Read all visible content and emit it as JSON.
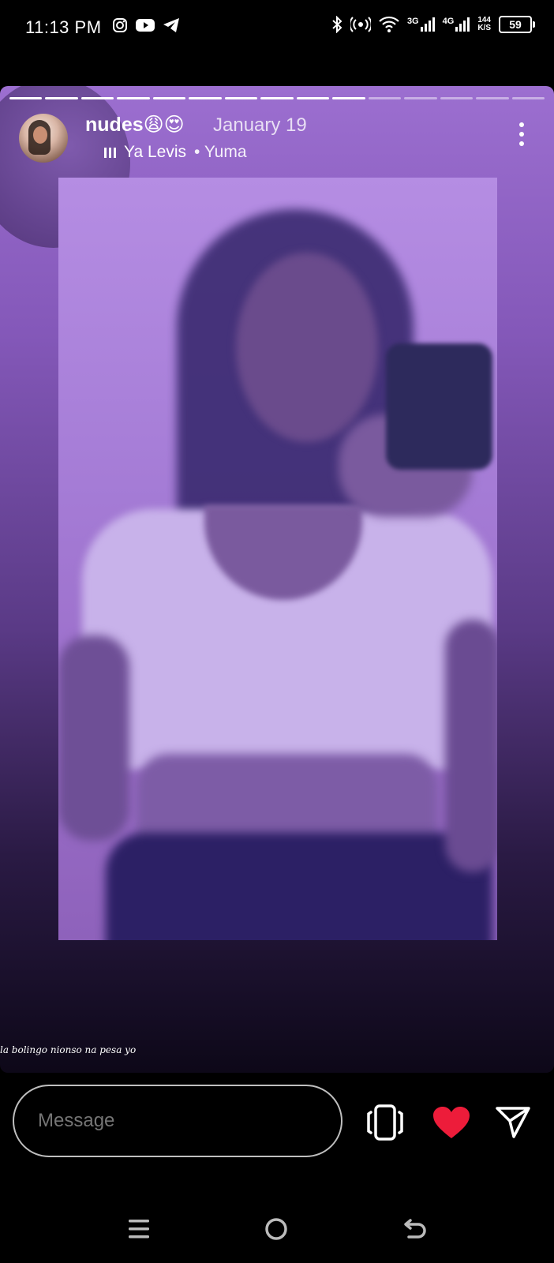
{
  "status_bar": {
    "time": "11:13 PM",
    "left_icons": [
      "instagram-icon",
      "youtube-icon",
      "telegram-icon"
    ],
    "right_icons": [
      "bluetooth-icon",
      "hotspot-icon",
      "wifi-icon",
      "signal-3g-icon",
      "signal-4g-icon"
    ],
    "net_3g": "3G",
    "net_4g": "4G",
    "speed_value": "144",
    "speed_unit": "K/S",
    "battery": "59"
  },
  "story": {
    "progress_total": 15,
    "progress_done": 10,
    "username": "nudes😩😍",
    "date": "January 19",
    "music_title": "Ya Levis",
    "music_separator": " • ",
    "music_artist": "Yuma",
    "caption": "la bolingo nionso na pesa yo",
    "background_colors": [
      "#9c6fd0",
      "#2a1a44"
    ]
  },
  "reply_bar": {
    "placeholder": "Message",
    "icons": [
      "sticker-icon",
      "heart-icon",
      "send-icon"
    ],
    "heart_color": "#ed1c3a"
  },
  "nav_bar": {
    "icons": [
      "menu-icon",
      "home-circle-icon",
      "back-icon"
    ]
  }
}
